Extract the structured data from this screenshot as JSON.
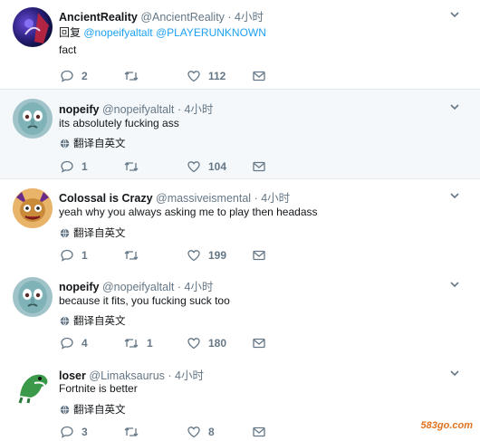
{
  "tweets": [
    {
      "name": "AncientReality",
      "handle": "@AncientReality",
      "time": "· 4小时",
      "reply_prefix": "回复",
      "mention1": "@nopeifyaltalt",
      "mention2": "@PLAYERUNKNOWN",
      "text": "fact",
      "replies": "2",
      "retweets": "",
      "likes": "112"
    },
    {
      "name": "nopeify",
      "handle": "@nopeifyaltalt",
      "time": "· 4小时",
      "text": "its absolutely fucking ass",
      "translate": "翻译自英文",
      "replies": "1",
      "retweets": "",
      "likes": "104"
    },
    {
      "name": "Colossal is Crazy",
      "handle": "@massiveismental",
      "time": "· 4小时",
      "text": "yeah why you always asking me to play then headass",
      "translate": "翻译自英文",
      "replies": "1",
      "retweets": "",
      "likes": "199"
    },
    {
      "name": "nopeify",
      "handle": "@nopeifyaltalt",
      "time": "· 4小时",
      "text": "because it fits, you fucking suck too",
      "translate": "翻译自英文",
      "replies": "4",
      "retweets": "1",
      "likes": "180"
    },
    {
      "name": "loser",
      "handle": "@Limaksaurus",
      "time": "· 4小时",
      "text": "Fortnite is better",
      "translate": "翻译自英文",
      "replies": "3",
      "retweets": "",
      "likes": "8"
    }
  ],
  "watermark": "583go.com",
  "colors": {
    "link": "#1da1f2",
    "meta": "#657786",
    "thread": "#ccd6dd"
  }
}
